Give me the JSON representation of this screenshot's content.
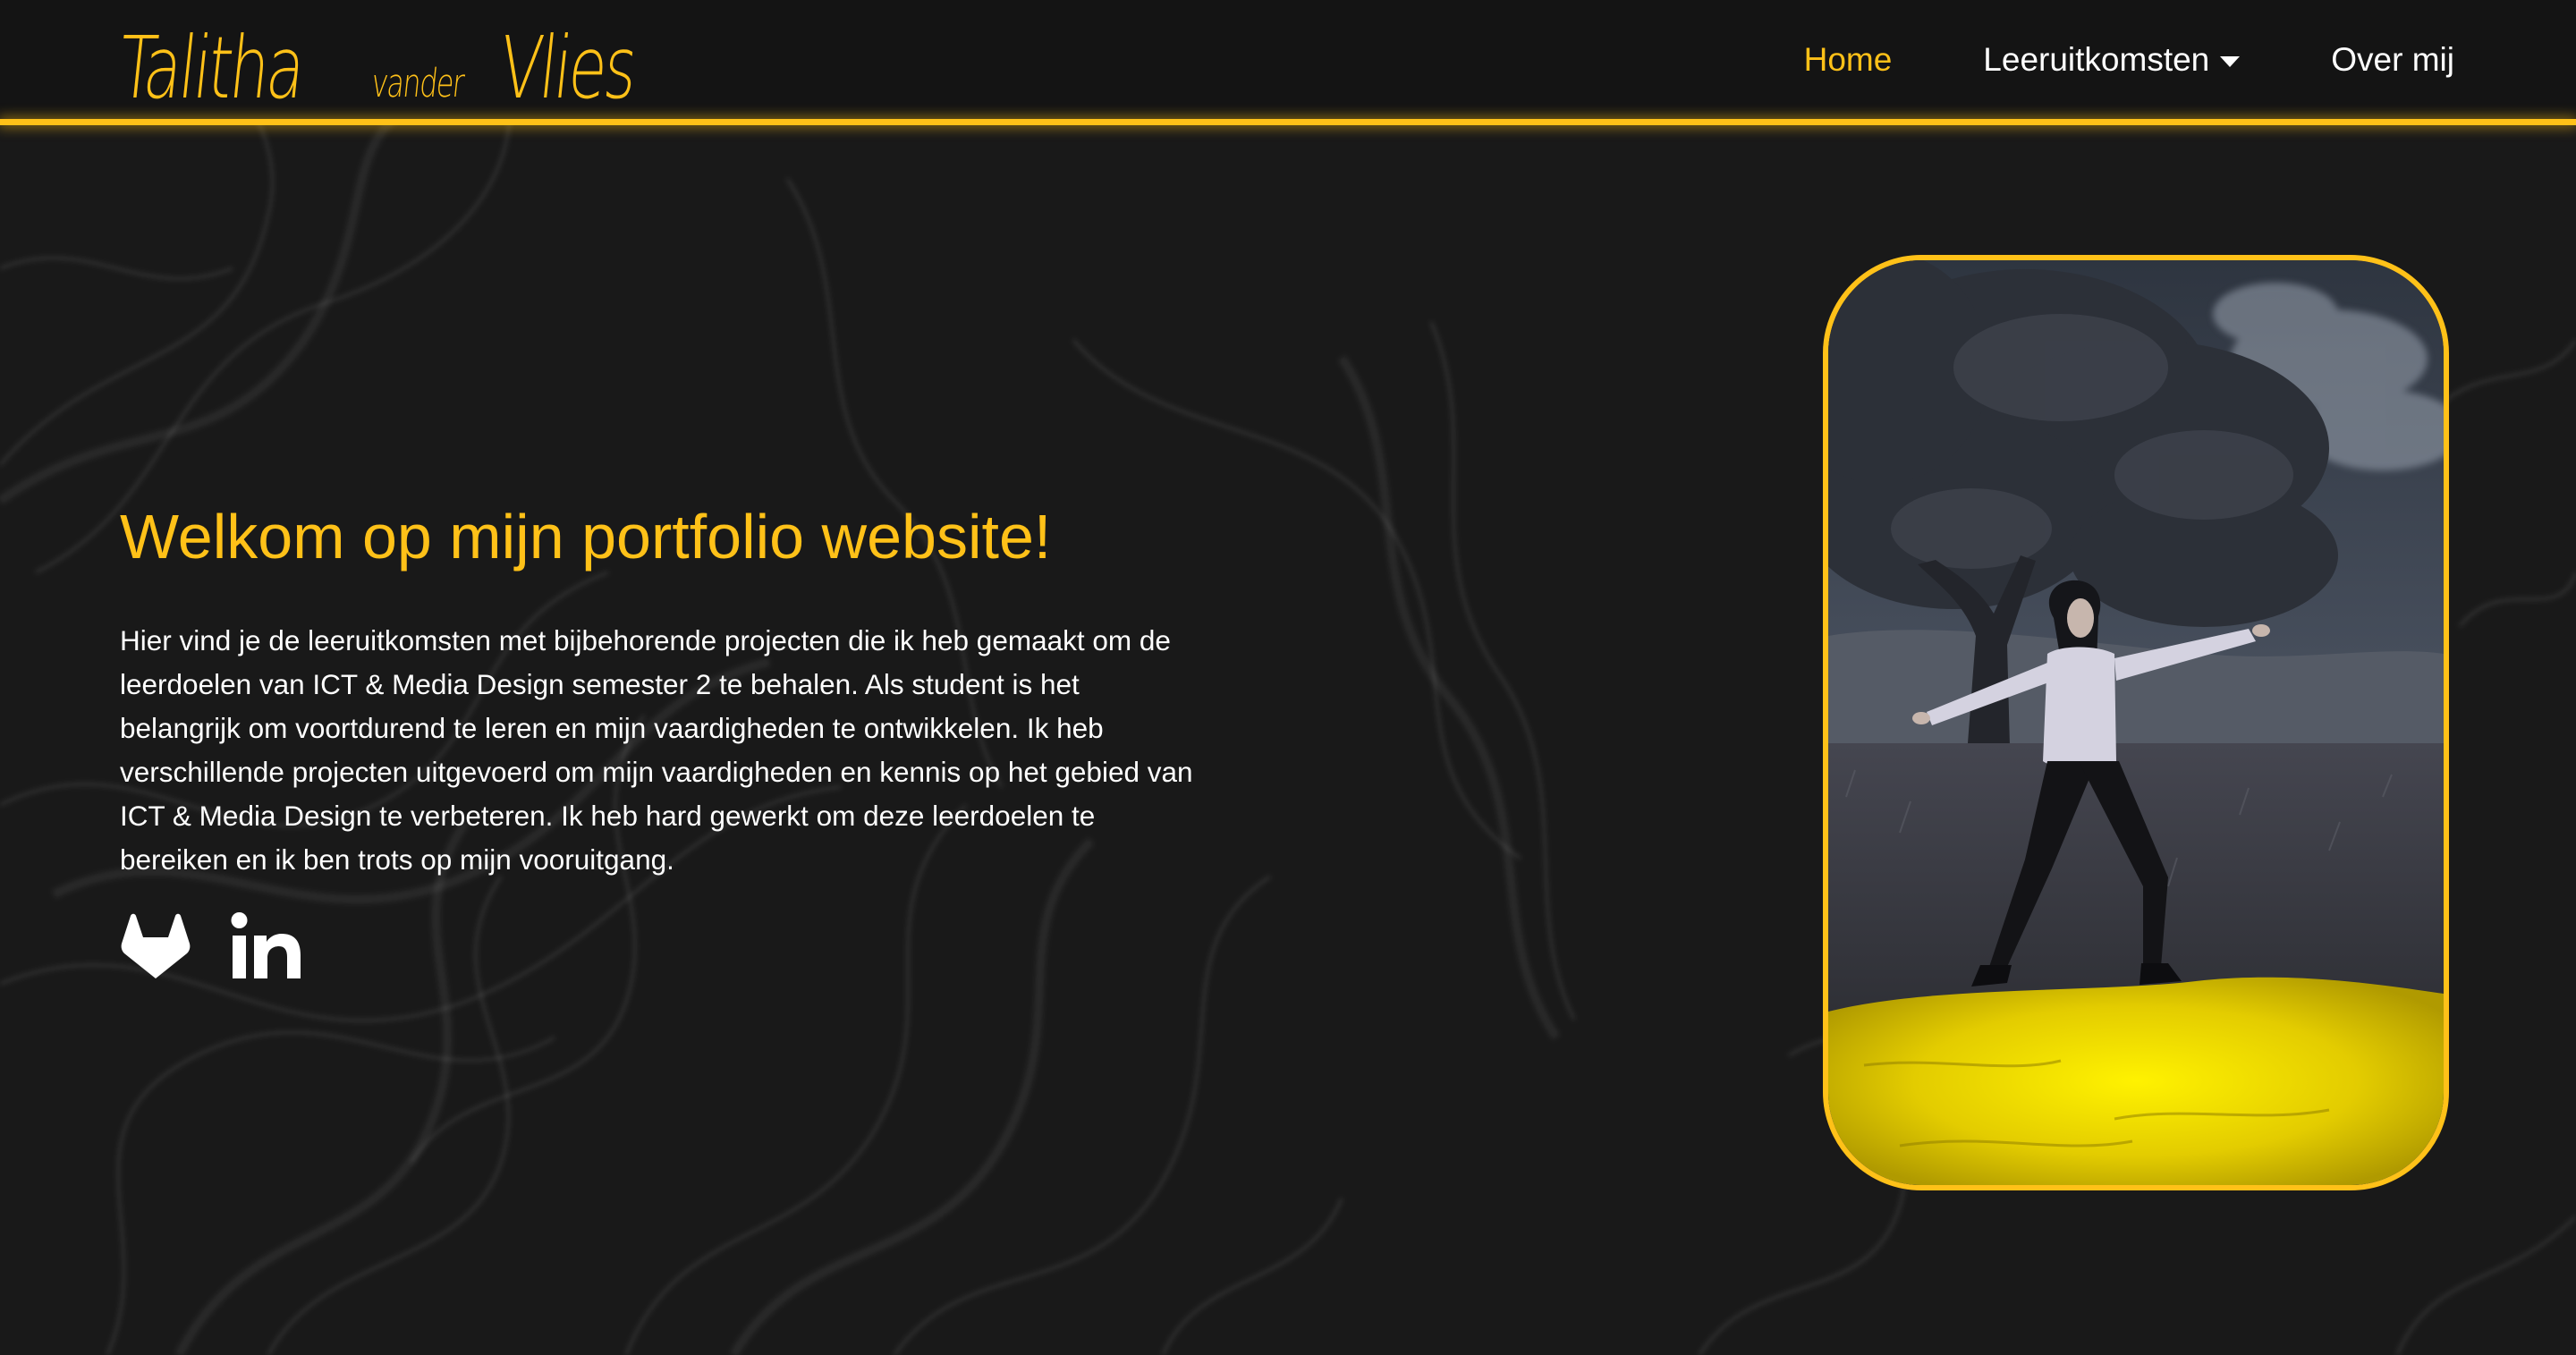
{
  "header": {
    "logo": {
      "first_name": "Talitha",
      "middle_name": "vander",
      "last_name": "Vlies"
    },
    "nav": {
      "home_label": "Home",
      "leeruitkomsten_label": "Leeruitkomsten",
      "over_mij_label": "Over mij",
      "active_item": "Home"
    }
  },
  "main": {
    "title": "Welkom op mijn portfolio website!",
    "intro_lines": [
      "Hier vind je de leeruitkomsten met bijbehorende projecten die ik heb gemaakt om de",
      "leerdoelen van ICT & Media Design semester 2 te behalen. Als student is het",
      "belangrijk om voortdurend te leren en mijn vaardigheden te ontwikkelen. Ik heb",
      "verschillende projecten uitgevoerd om mijn vaardigheden en kennis op het gebied van",
      "ICT & Media Design te verbeteren. Ik heb hard gewerkt om deze leerdoelen te",
      "bereiken en ik ben trots op mijn vooruitgang."
    ],
    "socials": [
      {
        "icon": "gitlab-icon"
      },
      {
        "icon": "linkedin-icon"
      }
    ],
    "photo": {
      "description_icon": "portrait-photo"
    }
  },
  "colors": {
    "accent": "#ffc118",
    "background": "#191919",
    "header_background": "#141414",
    "text": "#ffffff"
  }
}
